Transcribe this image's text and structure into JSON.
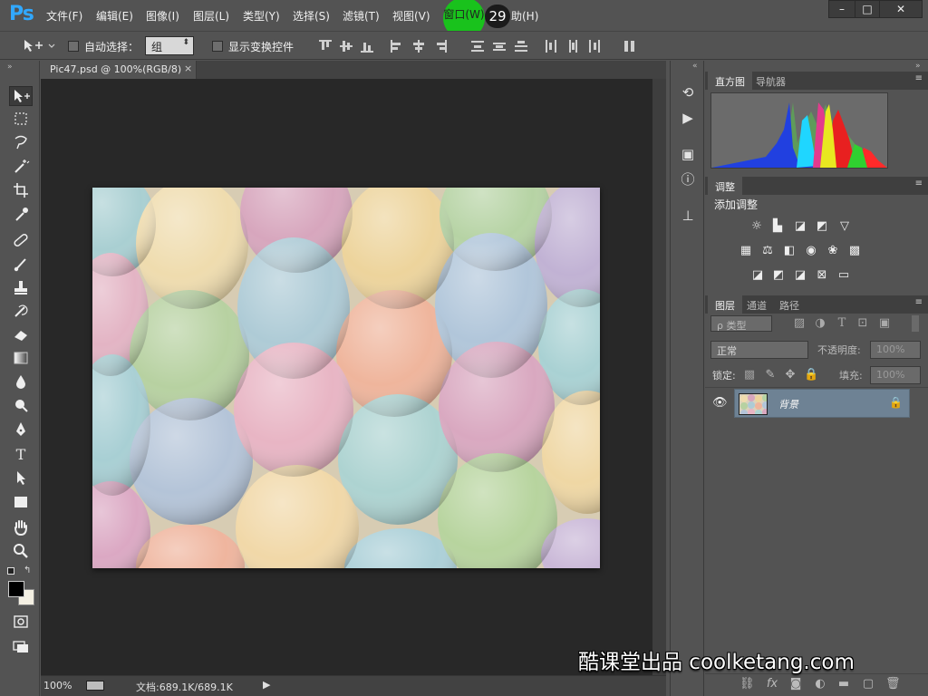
{
  "app": {
    "logo": "Ps",
    "menu": [
      "文件(F)",
      "编辑(E)",
      "图像(I)",
      "图层(L)",
      "类型(Y)",
      "选择(S)",
      "滤镜(T)",
      "视图(V)",
      "窗口(W)",
      "帮助(H)"
    ],
    "help_visible": "助(H)",
    "step_number": "29",
    "window_controls": [
      "–",
      "□",
      "✕"
    ]
  },
  "options": {
    "auto_select_label": "自动选择：",
    "auto_select_value": "组",
    "show_transform_label": "显示变换控件"
  },
  "document": {
    "tab_title": "Pic47.psd @ 100%(RGB/8)",
    "tab_close": "×",
    "zoom": "100%",
    "doc_info": "文档:689.1K/689.1K"
  },
  "panels": {
    "histogram_tabs": [
      "直方图",
      "导航器"
    ],
    "adjustments_tab": "调整",
    "adjustments_title": "添加调整",
    "layers_tabs": [
      "图层",
      "通道",
      "路径"
    ],
    "filter_kind": "ρ 类型",
    "blend_mode": "正常",
    "opacity_label": "不透明度:",
    "opacity_value": "100%",
    "lock_label": "锁定:",
    "fill_label": "填充:",
    "fill_value": "100%",
    "layer_name": "背景"
  },
  "watermark": "酷课堂出品 coolketang.com",
  "icons": {
    "tools": [
      "move-tool",
      "marquee-tool",
      "lasso-tool",
      "magic-wand-tool",
      "crop-tool",
      "eyedropper-tool",
      "healing-brush-tool",
      "brush-tool",
      "clone-stamp-tool",
      "history-brush-tool",
      "eraser-tool",
      "gradient-tool",
      "blur-tool",
      "dodge-tool",
      "pen-tool",
      "type-tool",
      "path-selection-tool",
      "rectangle-tool",
      "hand-tool",
      "zoom-tool"
    ]
  },
  "colors": {
    "accent": "#31a8ff",
    "click_marker": "#19c21c",
    "selected_layer": "#6e8294"
  }
}
